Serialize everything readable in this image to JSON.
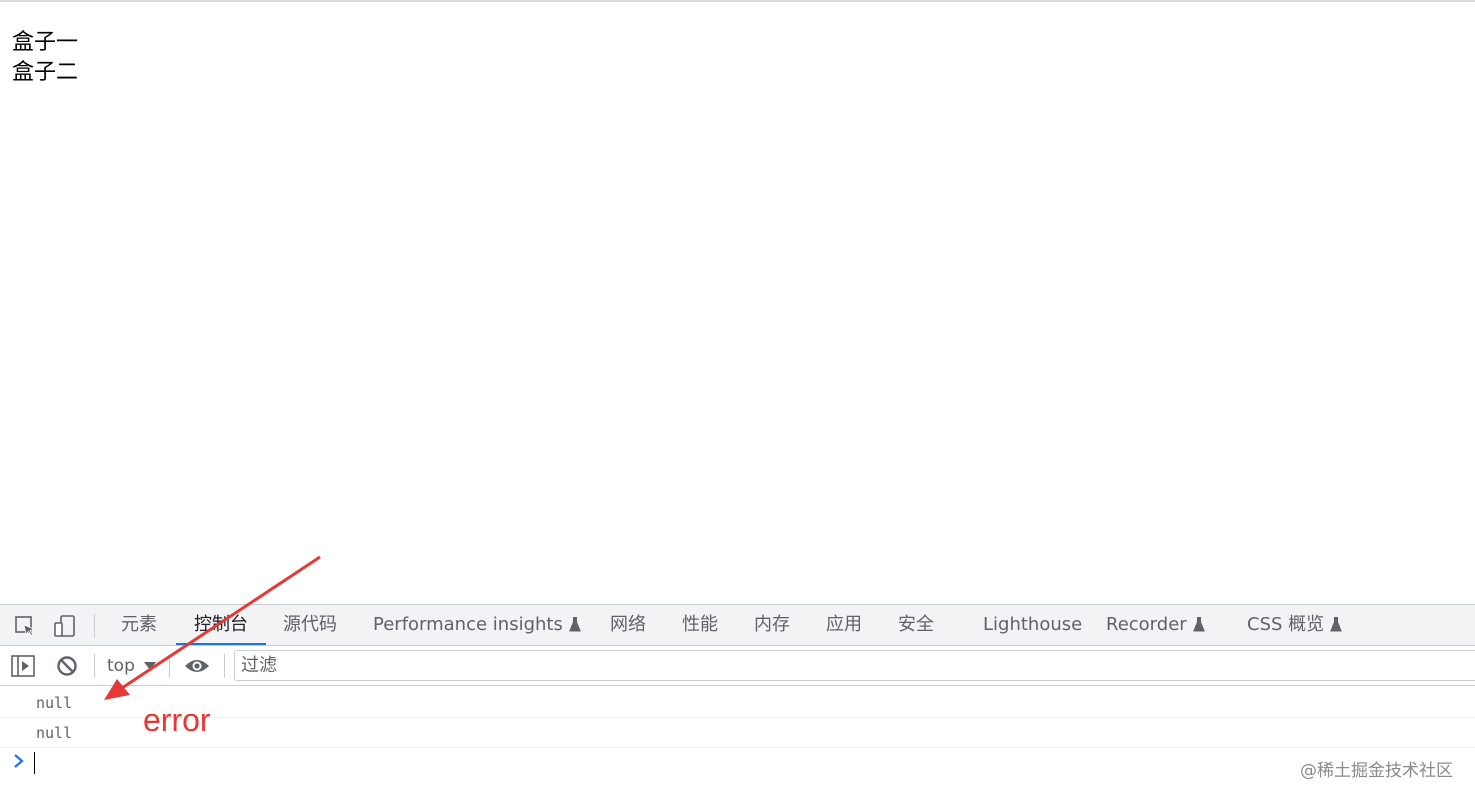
{
  "page": {
    "boxes": [
      "盒子一",
      "盒子二"
    ]
  },
  "devtools": {
    "tabs": [
      {
        "label": "元素",
        "experimental": false
      },
      {
        "label": "控制台",
        "experimental": false,
        "active": true
      },
      {
        "label": "源代码",
        "experimental": false
      },
      {
        "label": "Performance insights",
        "experimental": true
      },
      {
        "label": "网络",
        "experimental": false
      },
      {
        "label": "性能",
        "experimental": false
      },
      {
        "label": "内存",
        "experimental": false
      },
      {
        "label": "应用",
        "experimental": false
      },
      {
        "label": "安全",
        "experimental": false
      },
      {
        "label": "Lighthouse",
        "experimental": false
      },
      {
        "label": "Recorder",
        "experimental": true
      },
      {
        "label": "CSS 概览",
        "experimental": true
      }
    ],
    "toolbar": {
      "context": "top",
      "filter_placeholder": "过滤"
    },
    "console_lines": [
      "null",
      "null"
    ],
    "accent_color": "#1a73e8"
  },
  "annotation": {
    "text": "error",
    "color": "#e53935"
  },
  "watermark": "@稀土掘金技术社区"
}
